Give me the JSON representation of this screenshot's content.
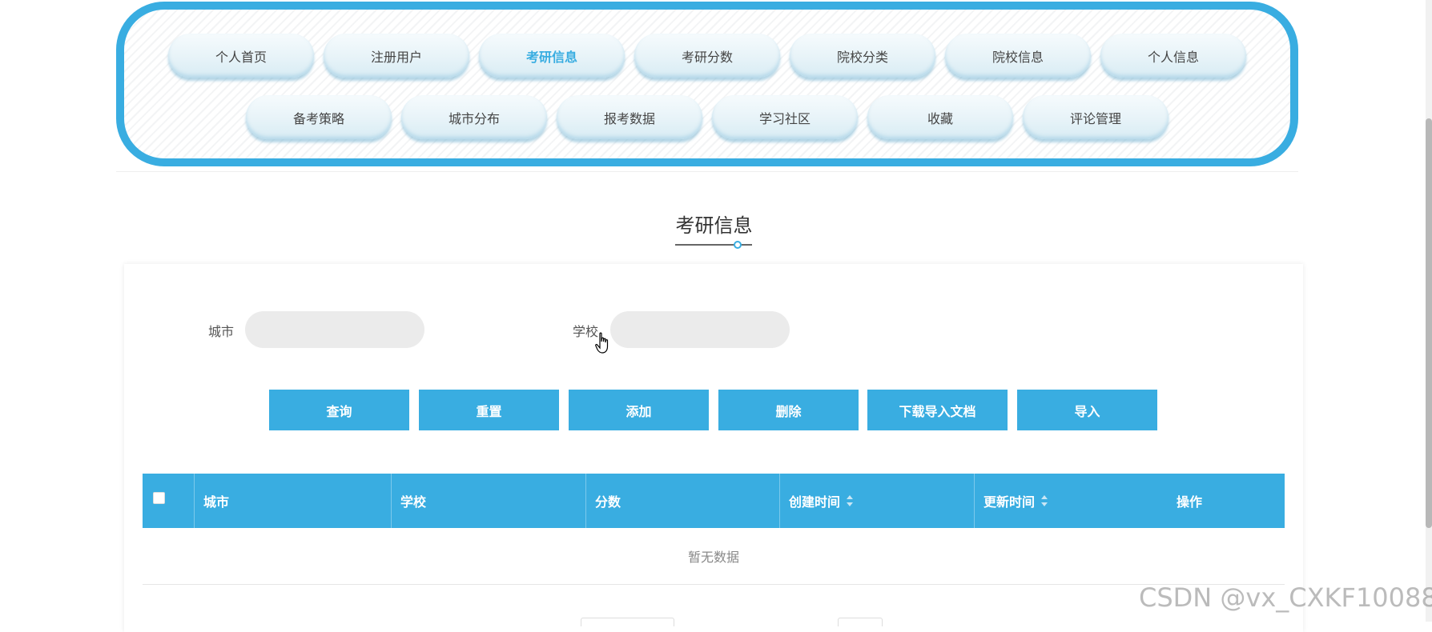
{
  "nav": {
    "row1": [
      "个人首页",
      "注册用户",
      "考研信息",
      "考研分数",
      "院校分类",
      "院校信息",
      "个人信息"
    ],
    "row2": [
      "备考策略",
      "城市分布",
      "报考数据",
      "学习社区",
      "收藏",
      "评论管理"
    ],
    "active": "考研信息"
  },
  "page": {
    "title": "考研信息"
  },
  "search": {
    "city_label": "城市",
    "city_value": "",
    "city_placeholder": "",
    "school_label": "学校",
    "school_value": "",
    "school_placeholder": ""
  },
  "actions": {
    "query": "查询",
    "reset": "重置",
    "add": "添加",
    "delete": "删除",
    "download_template": "下载导入文档",
    "import": "导入"
  },
  "table": {
    "columns": {
      "city": "城市",
      "school": "学校",
      "score": "分数",
      "created": "创建时间",
      "updated": "更新时间",
      "ops": "操作"
    },
    "empty_text": "暂无数据"
  },
  "watermark": "CSDN @vx_CXKF10088",
  "colors": {
    "accent": "#39ade1",
    "input_bg": "#ebebeb"
  },
  "icons": [
    "checkbox-icon",
    "sort-icon",
    "hand-cursor-icon"
  ]
}
